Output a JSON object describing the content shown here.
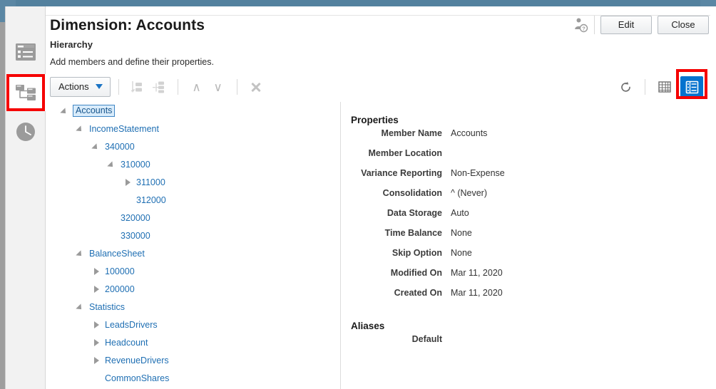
{
  "window": {
    "title": "Dimension: Accounts",
    "subtitle": "Hierarchy",
    "description": "Add members and define their properties."
  },
  "header": {
    "member_info_icon": "user-question-icon",
    "edit_label": "Edit",
    "close_label": "Close"
  },
  "toolbar": {
    "actions_label": "Actions",
    "add_sibling_icon": "add-sibling-icon",
    "add_child_icon": "add-child-icon",
    "move_up_icon": "chevron-up-icon",
    "move_up_glyph": "∧",
    "move_down_icon": "chevron-down-icon",
    "move_down_glyph": "∨",
    "delete_icon": "close-x-icon",
    "refresh_icon": "refresh-icon",
    "grid_view_icon": "grid-view-icon",
    "detail_view_icon": "detail-view-icon",
    "accent_selected": "#0572ce",
    "highlight_color": "#f50000"
  },
  "sidebar": {
    "items": [
      {
        "name": "sidebar-item-dimensions",
        "icon": "list-form-icon",
        "active": false
      },
      {
        "name": "sidebar-item-hierarchy",
        "icon": "hierarchy-tree-icon",
        "active": true
      },
      {
        "name": "sidebar-item-history",
        "icon": "clock-icon",
        "active": false
      }
    ]
  },
  "tree": {
    "nodes": [
      {
        "label": "Accounts",
        "depth": 0,
        "twist": "open",
        "selected": true
      },
      {
        "label": "IncomeStatement",
        "depth": 1,
        "twist": "open",
        "selected": false
      },
      {
        "label": "340000",
        "depth": 2,
        "twist": "open",
        "selected": false
      },
      {
        "label": "310000",
        "depth": 3,
        "twist": "open",
        "selected": false
      },
      {
        "label": "311000",
        "depth": 4,
        "twist": "closed",
        "selected": false
      },
      {
        "label": "312000",
        "depth": 4,
        "twist": "none",
        "selected": false
      },
      {
        "label": "320000",
        "depth": 3,
        "twist": "none",
        "selected": false
      },
      {
        "label": "330000",
        "depth": 3,
        "twist": "none",
        "selected": false
      },
      {
        "label": "BalanceSheet",
        "depth": 1,
        "twist": "open",
        "selected": false
      },
      {
        "label": "100000",
        "depth": 2,
        "twist": "closed",
        "selected": false
      },
      {
        "label": "200000",
        "depth": 2,
        "twist": "closed",
        "selected": false
      },
      {
        "label": "Statistics",
        "depth": 1,
        "twist": "open",
        "selected": false
      },
      {
        "label": "LeadsDrivers",
        "depth": 2,
        "twist": "closed",
        "selected": false
      },
      {
        "label": "Headcount",
        "depth": 2,
        "twist": "closed",
        "selected": false
      },
      {
        "label": "RevenueDrivers",
        "depth": 2,
        "twist": "closed",
        "selected": false
      },
      {
        "label": "CommonShares",
        "depth": 2,
        "twist": "none",
        "selected": false
      }
    ]
  },
  "properties": {
    "section_title": "Properties",
    "rows": [
      {
        "label": "Member Name",
        "value": "Accounts"
      },
      {
        "label": "Member Location",
        "value": ""
      },
      {
        "label": "Variance Reporting",
        "value": "Non-Expense"
      },
      {
        "label": "Consolidation",
        "value": "^ (Never)"
      },
      {
        "label": "Data Storage",
        "value": "Auto"
      },
      {
        "label": "Time Balance",
        "value": "None"
      },
      {
        "label": "Skip Option",
        "value": "None"
      },
      {
        "label": "Modified On",
        "value": "Mar 11, 2020"
      },
      {
        "label": "Created On",
        "value": "Mar 11, 2020"
      }
    ]
  },
  "aliases": {
    "section_title": "Aliases",
    "rows": [
      {
        "label": "Default",
        "value": ""
      }
    ]
  }
}
